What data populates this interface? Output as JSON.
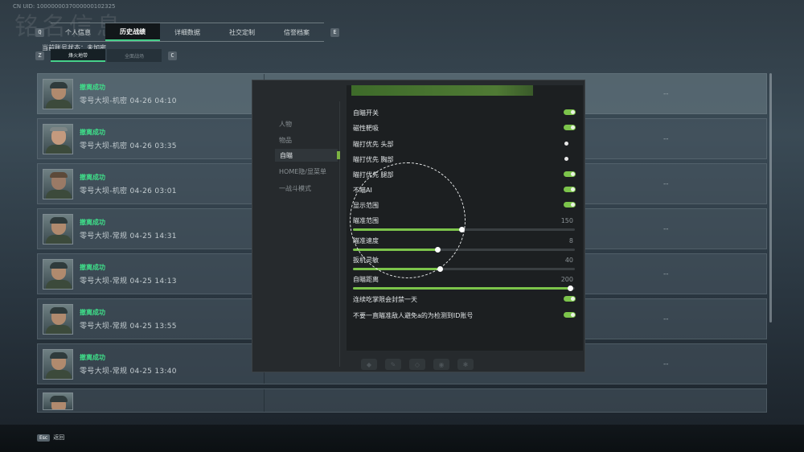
{
  "header": {
    "uid": "CN UID: 1000000037000000102325",
    "watermark": "铭名信息"
  },
  "tabbar": {
    "key_left": "Q",
    "key_right": "E",
    "tabs": [
      "个人信息",
      "历史战绩",
      "详细数据",
      "社交定制",
      "信誉档案"
    ],
    "active_index": 1
  },
  "status": {
    "text": "当前账号状态：未加密"
  },
  "subbar": {
    "key_left": "Z",
    "key_right": "C",
    "tabs": [
      "烽火地带",
      "全面战场"
    ]
  },
  "records": [
    {
      "result": "撤离成功",
      "detail": "零号大坝-机密 04-26 04:10",
      "extra": "--"
    },
    {
      "result": "撤离成功",
      "detail": "零号大坝-机密 04-26 03:35",
      "extra": "--"
    },
    {
      "result": "撤离成功",
      "detail": "零号大坝-机密 04-26 03:01",
      "extra": "--"
    },
    {
      "result": "撤离成功",
      "detail": "零号大坝-常规 04-25 14:31",
      "extra": "--"
    },
    {
      "result": "撤离成功",
      "detail": "零号大坝-常规 04-25 14:13",
      "extra": "--"
    },
    {
      "result": "撤离成功",
      "detail": "零号大坝-常规 04-25 13:55",
      "extra": "--"
    },
    {
      "result": "撤离成功",
      "detail": "零号大坝-常规 04-25 13:40",
      "extra": "--"
    }
  ],
  "cheat_menu": {
    "categories": [
      "人物",
      "物品",
      "自瞄",
      "HOME隐/显菜单",
      "一战斗模式"
    ],
    "selected_index": 2,
    "toggles": [
      {
        "label": "自瞄开关",
        "on": true
      },
      {
        "label": "磁性靶吸",
        "on": true
      },
      {
        "label": "瞄打优先 头部",
        "on": false
      },
      {
        "label": "瞄打优先 胸部",
        "on": false
      },
      {
        "label": "瞄打优先 腿部",
        "on": true
      },
      {
        "label": "不瞄AI",
        "on": true
      },
      {
        "label": "显示范围",
        "on": true
      }
    ],
    "sliders": [
      {
        "label": "瞄准范围",
        "value": "150",
        "fraction": 0.49
      },
      {
        "label": "瞄准速度",
        "value": "8",
        "fraction": 0.38
      },
      {
        "label": "扳机灵敏",
        "value": "40",
        "fraction": 0.39
      },
      {
        "label": "自瞄距离",
        "value": "200",
        "fraction": 0.98
      }
    ],
    "bottom_toggles": [
      {
        "label": "连续吃掌限会封禁一天",
        "on": true
      },
      {
        "label": "不要一直瞄准敌人避免a的为检测到ID账号",
        "on": true
      }
    ]
  },
  "footer": {
    "esc_key": "Esc",
    "esc_label": "返回"
  }
}
